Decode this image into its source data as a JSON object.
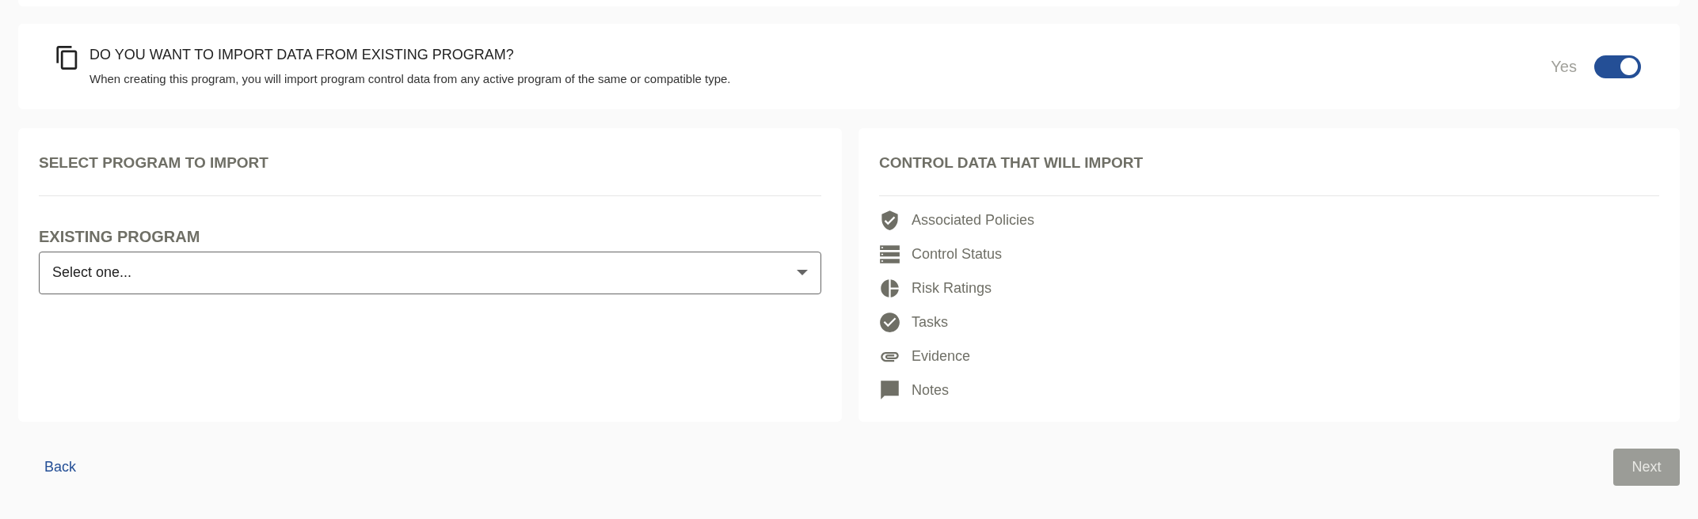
{
  "import_prompt": {
    "title": "DO YOU WANT TO IMPORT DATA FROM EXISTING PROGRAM?",
    "description": "When creating this program, you will import program control data from any active program of the same or compatible type.",
    "toggle_label": "Yes",
    "on": true
  },
  "select_panel": {
    "title": "SELECT PROGRAM TO IMPORT",
    "field_label": "EXISTING PROGRAM",
    "dropdown": {
      "value": "Select one..."
    }
  },
  "control_panel": {
    "title": "CONTROL DATA THAT WILL IMPORT",
    "items": [
      {
        "kind": "shield",
        "label": "Associated Policies"
      },
      {
        "kind": "list",
        "label": "Control Status"
      },
      {
        "kind": "pie",
        "label": "Risk Ratings"
      },
      {
        "kind": "check",
        "label": "Tasks"
      },
      {
        "kind": "clip",
        "label": "Evidence"
      },
      {
        "kind": "note",
        "label": "Notes"
      }
    ]
  },
  "footer": {
    "back": "Back",
    "next": {
      "label": "Next",
      "disabled": true
    }
  }
}
